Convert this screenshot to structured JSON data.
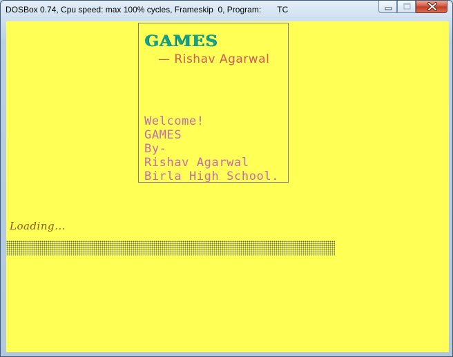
{
  "window": {
    "title": "DOSBox 0.74, Cpu speed: max 100% cycles, Frameskip  0, Program:       TC",
    "buttons": {
      "minimize_icon": "minimize-icon",
      "maximize_icon": "maximize-icon",
      "close_icon": "close-icon"
    }
  },
  "colors": {
    "screen_background": "#ffff55",
    "title_green": "#13a38b",
    "author_red": "#d55757",
    "credits_magenta": "#c76aa8",
    "loading_brown": "#8a5a1a"
  },
  "splash": {
    "title": "GAMES",
    "author": "— Rishav Agarwal",
    "credits": [
      "Welcome!",
      "GAMES",
      "By-",
      "Rishav Agarwal",
      "Birla High School."
    ]
  },
  "loading": {
    "label": "Loading...",
    "progress": 0.86
  }
}
